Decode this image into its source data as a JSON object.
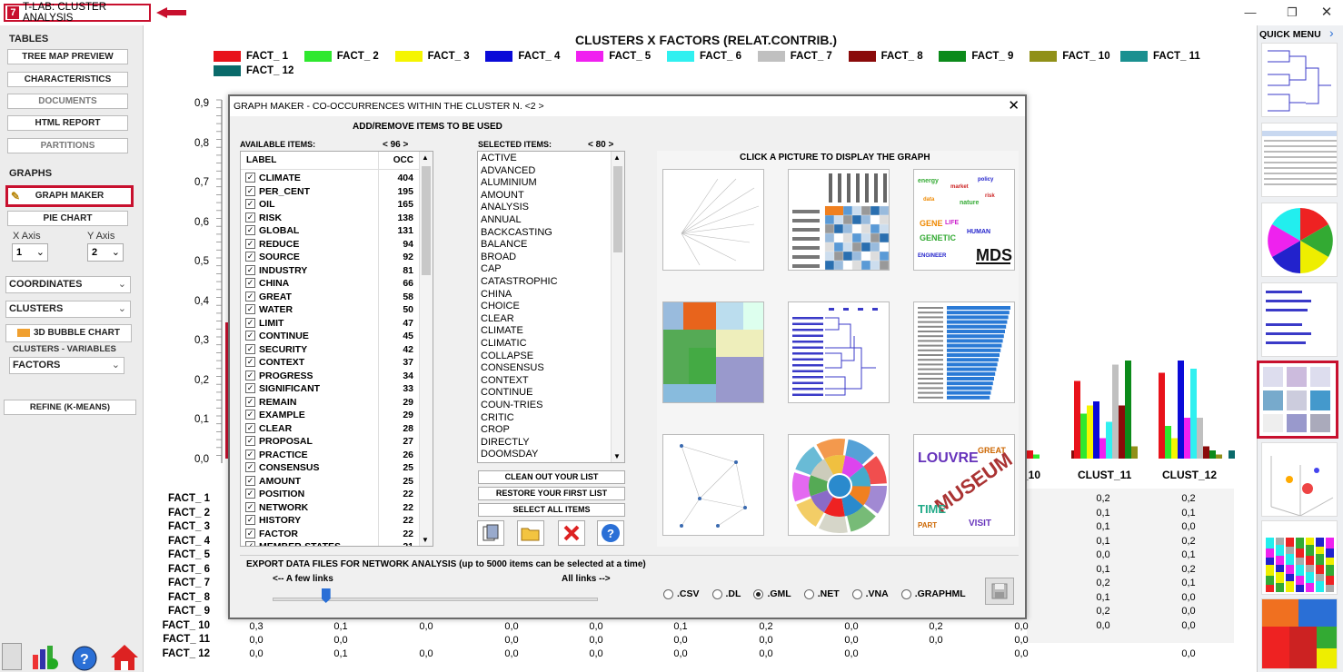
{
  "app": {
    "title": "T-LAB: CLUSTER ANALYSIS"
  },
  "left": {
    "tables_label": "TABLES",
    "tree_map": "TREE MAP PREVIEW",
    "characteristics": "CHARACTERISTICS",
    "documents": "DOCUMENTS",
    "html_report": "HTML REPORT",
    "partitions": "PARTITIONS",
    "graphs_label": "GRAPHS",
    "graph_maker": "GRAPH MAKER",
    "pie_chart": "PIE CHART",
    "x_axis_label": "X Axis",
    "y_axis_label": "Y Axis",
    "x_axis_value": "1",
    "y_axis_value": "2",
    "coordinates": "COORDINATES",
    "clusters": "CLUSTERS",
    "bubble": "3D BUBBLE CHART",
    "clusters_variables": "CLUSTERS - VARIABLES",
    "factors": "FACTORS",
    "refine": "REFINE (K-MEANS)"
  },
  "chart": {
    "title": "CLUSTERS X FACTORS (RELAT.CONTRIB.)",
    "legend": [
      {
        "name": "FACT_ 1",
        "color": "#e8121a"
      },
      {
        "name": "FACT_ 2",
        "color": "#2ee82e"
      },
      {
        "name": "FACT_ 3",
        "color": "#f5f500"
      },
      {
        "name": "FACT_ 4",
        "color": "#0a0ad8"
      },
      {
        "name": "FACT_ 5",
        "color": "#f020f0"
      },
      {
        "name": "FACT_ 6",
        "color": "#30f0f0"
      },
      {
        "name": "FACT_ 7",
        "color": "#c0c0c0"
      },
      {
        "name": "FACT_ 8",
        "color": "#8a0a0a"
      },
      {
        "name": "FACT_ 9",
        "color": "#0b8a1a"
      },
      {
        "name": "FACT_ 10",
        "color": "#909018"
      },
      {
        "name": "FACT_ 11",
        "color": "#1a9090"
      },
      {
        "name": "FACT_ 12",
        "color": "#0a6a6a"
      }
    ],
    "yticks": [
      "0,9",
      "0,8",
      "0,7",
      "0,6",
      "0,5",
      "0,4",
      "0,3",
      "0,2",
      "0,1",
      "0,0"
    ],
    "x_labels_visible": [
      "_10",
      "CLUST_11",
      "CLUST_12"
    ],
    "row_labels": [
      "FACT_ 1",
      "FACT_ 2",
      "FACT_ 3",
      "FACT_ 4",
      "FACT_ 5",
      "FACT_ 6",
      "FACT_ 7",
      "FACT_ 8",
      "FACT_ 9",
      "FACT_ 10",
      "FACT_ 11",
      "FACT_ 12"
    ],
    "clust11_col": [
      "0,2",
      "0,1",
      "0,1",
      "0,1",
      "0,0",
      "0,1",
      "0,2",
      "0,1",
      "0,2",
      "0,0",
      "",
      ""
    ],
    "clust12_col": [
      "0,2",
      "0,1",
      "0,0",
      "0,2",
      "0,1",
      "0,2",
      "0,1",
      "0,0",
      "0,0",
      "0,0",
      "",
      "0,0"
    ],
    "row10": [
      "0,3",
      "0,1",
      "0,0",
      "0,0",
      "0,0",
      "0,1",
      "0,2",
      "0,0",
      "0,2",
      "0,0"
    ],
    "row11": [
      "0,0",
      "0,0",
      "",
      "0,0",
      "0,0",
      "0,0",
      "0,0",
      "0,0",
      "0,0",
      "0,0"
    ],
    "row12": [
      "0,0",
      "0,1",
      "0,0",
      "0,0",
      "0,0",
      "0,0",
      "0,0",
      "0,0",
      "",
      "0,0"
    ]
  },
  "quick_menu": {
    "label": "QUICK MENU"
  },
  "dialog": {
    "title": "GRAPH MAKER - CO-OCCURRENCES WITHIN THE CLUSTER N.  <2 >",
    "add_remove": "ADD/REMOVE ITEMS TO BE USED",
    "available_label": "AVAILABLE ITEMS:",
    "available_count": "< 96 >",
    "selected_label": "SELECTED ITEMS:",
    "selected_count": "< 80 >",
    "col_label": "LABEL",
    "col_occ": "OCC",
    "available": [
      [
        "CLIMATE",
        "404"
      ],
      [
        "PER_CENT",
        "195"
      ],
      [
        "OIL",
        "165"
      ],
      [
        "RISK",
        "138"
      ],
      [
        "GLOBAL",
        "131"
      ],
      [
        "REDUCE",
        "94"
      ],
      [
        "SOURCE",
        "92"
      ],
      [
        "INDUSTRY",
        "81"
      ],
      [
        "CHINA",
        "66"
      ],
      [
        "GREAT",
        "58"
      ],
      [
        "WATER",
        "50"
      ],
      [
        "LIMIT",
        "47"
      ],
      [
        "CONTINUE",
        "45"
      ],
      [
        "SECURITY",
        "42"
      ],
      [
        "CONTEXT",
        "37"
      ],
      [
        "PROGRESS",
        "34"
      ],
      [
        "SIGNIFICANT",
        "33"
      ],
      [
        "REMAIN",
        "29"
      ],
      [
        "EXAMPLE",
        "29"
      ],
      [
        "CLEAR",
        "28"
      ],
      [
        "PROPOSAL",
        "27"
      ],
      [
        "PRACTICE",
        "26"
      ],
      [
        "CONSENSUS",
        "25"
      ],
      [
        "AMOUNT",
        "25"
      ],
      [
        "POSITION",
        "22"
      ],
      [
        "NETWORK",
        "22"
      ],
      [
        "HISTORY",
        "22"
      ],
      [
        "FACTOR",
        "22"
      ],
      [
        "MEMBER-STATES",
        "21"
      ]
    ],
    "selected": [
      "ACTIVE",
      "ADVANCED",
      "ALUMINIUM",
      "AMOUNT",
      "ANALYSIS",
      "ANNUAL",
      "BACKCASTING",
      "BALANCE",
      "BROAD",
      "CAP",
      "CATASTROPHIC",
      "CHINA",
      "CHOICE",
      "CLEAR",
      "CLIMATE",
      "CLIMATIC",
      "COLLAPSE",
      "CONSENSUS",
      "CONTEXT",
      "CONTINUE",
      "COUN-TRIES",
      "CRITIC",
      "CROP",
      "DIRECTLY",
      "DOOMSDAY"
    ],
    "clean_btn": "CLEAN OUT YOUR LIST",
    "restore_btn": "RESTORE YOUR FIRST  LIST",
    "select_all_btn": "SELECT ALL ITEMS",
    "click_picture": "CLICK A PICTURE TO DISPLAY THE GRAPH",
    "export_label": "EXPORT DATA FILES FOR NETWORK ANALYSIS (up to 5000 items can be selected at a time)",
    "few_links": "<-- A few links",
    "all_links": "All links -->",
    "slider_value": 0.15,
    "formats": [
      ".CSV",
      ".DL",
      ".GML",
      ".NET",
      ".VNA",
      ".GRAPHML"
    ],
    "format_selected": ".GML",
    "mds_text": "MDS"
  }
}
